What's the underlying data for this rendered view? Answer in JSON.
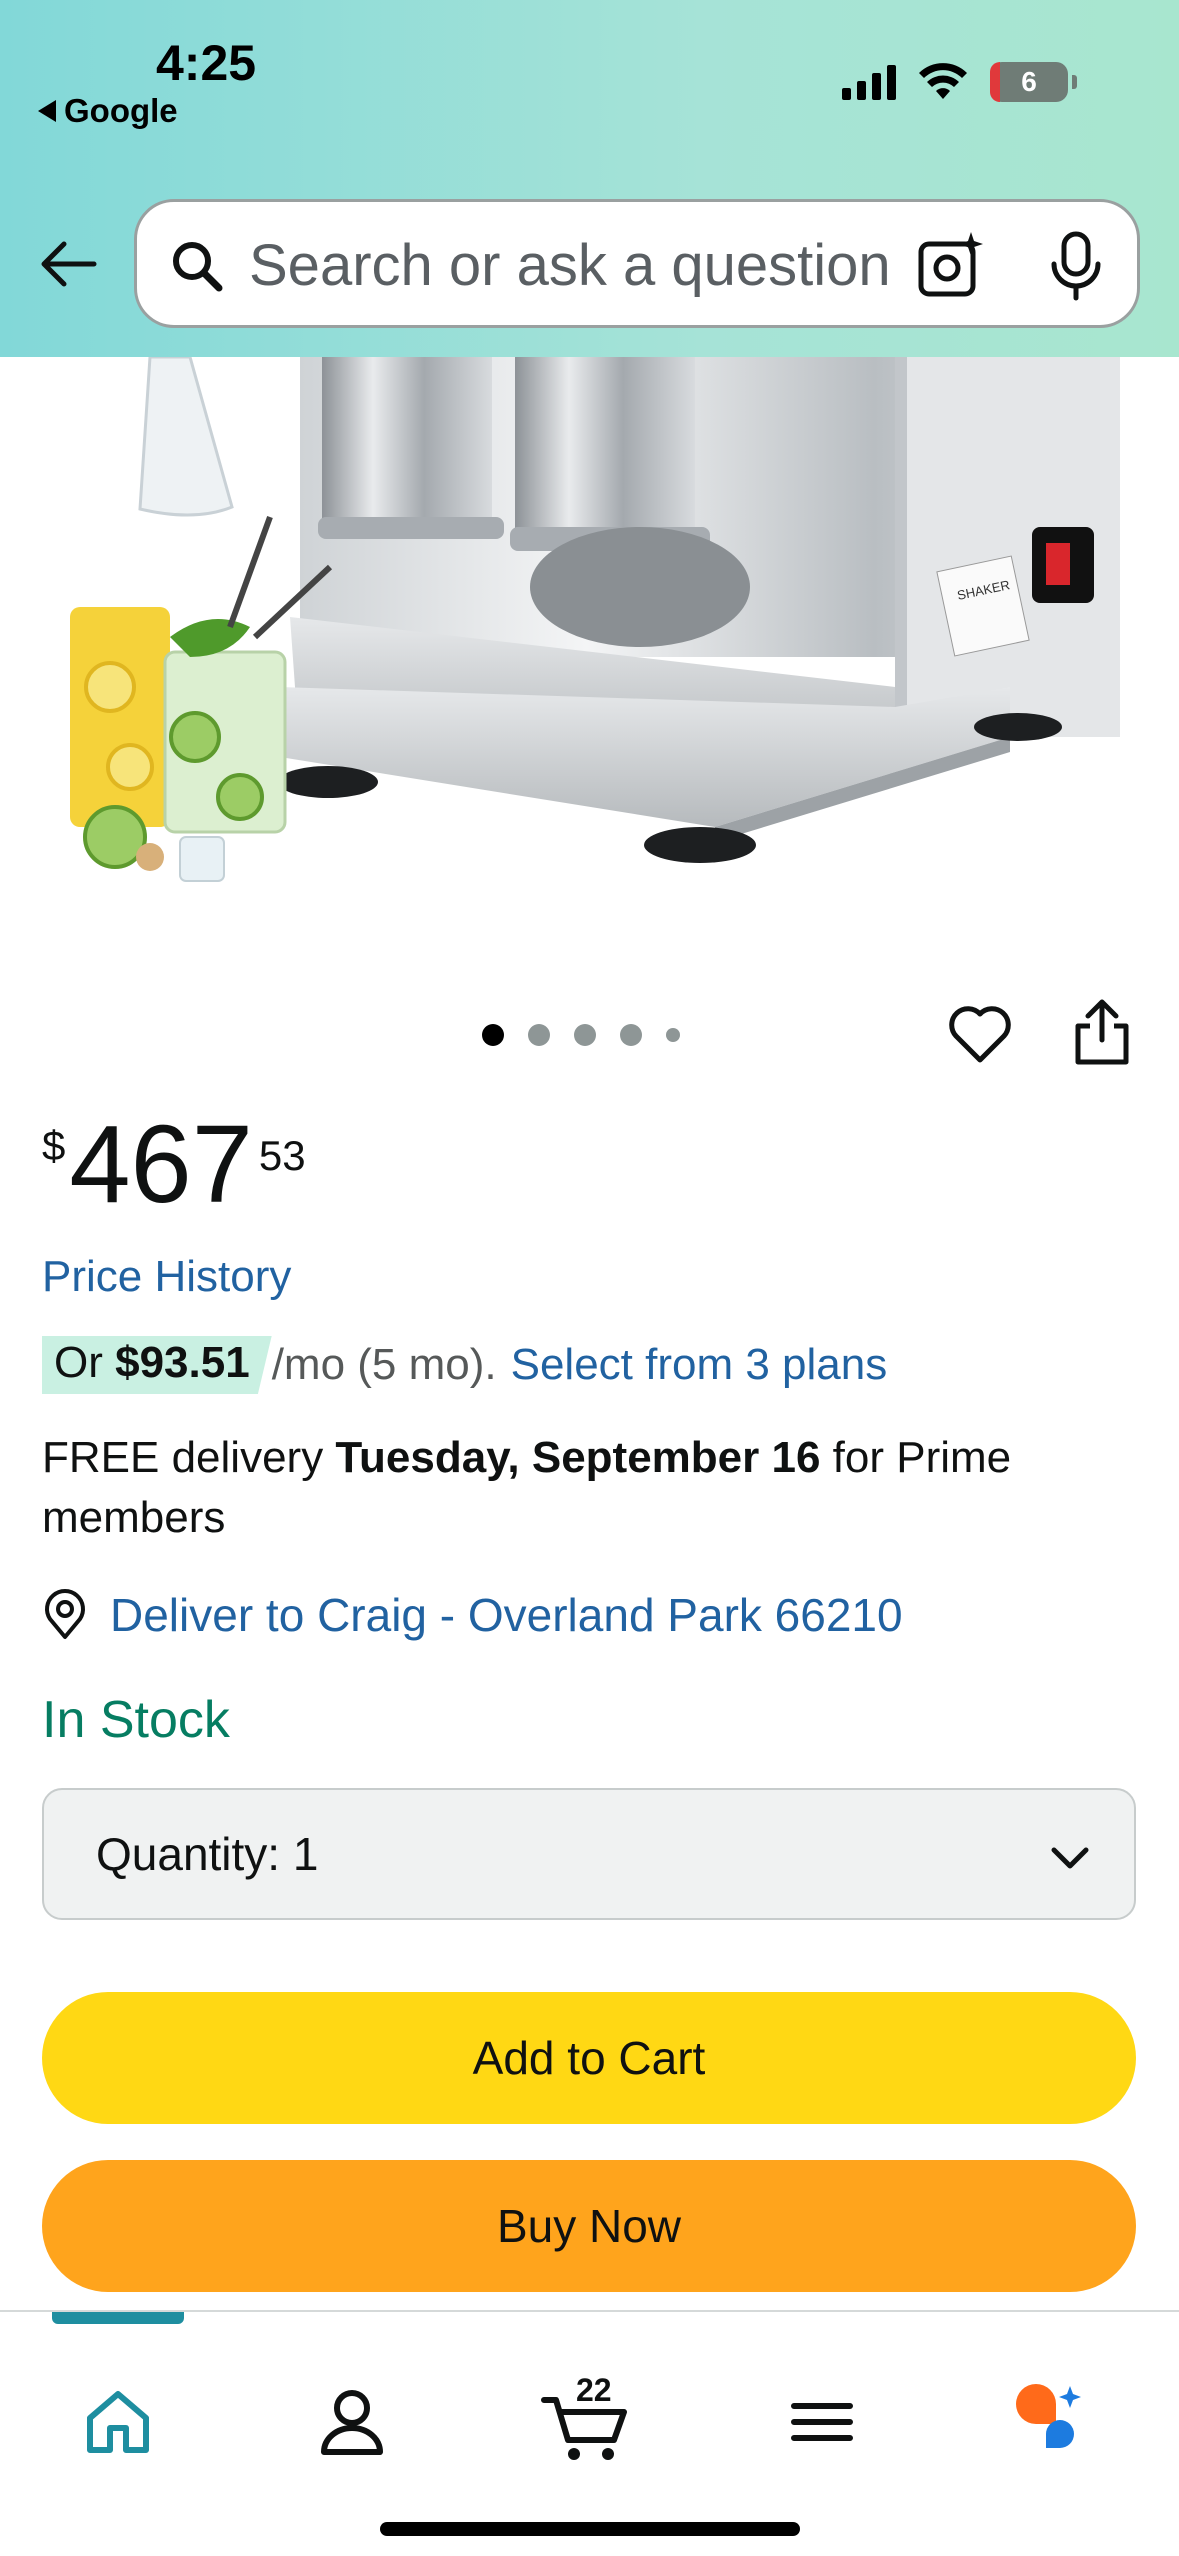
{
  "status_bar": {
    "time": "4:25",
    "back_app": "Google",
    "battery": "6"
  },
  "search": {
    "placeholder": "Search or ask a question"
  },
  "gallery": {
    "dot_count": 5,
    "active_index": 0,
    "label_text": "SHAKER"
  },
  "price": {
    "symbol": "$",
    "whole": "467",
    "fraction": "53"
  },
  "price_history_link": "Price History",
  "installment": {
    "prefix": "Or ",
    "amount": "$93.51",
    "terms": " /mo (5 mo). ",
    "link": "Select from 3 plans"
  },
  "delivery": {
    "prefix": "FREE delivery ",
    "date": "Tuesday, September 16",
    "suffix": " for Prime members"
  },
  "deliver_to": "Deliver to Craig - Overland Park 66210",
  "stock_status": "In Stock",
  "quantity": {
    "label": "Quantity:",
    "value": "1"
  },
  "buttons": {
    "add_to_cart": "Add to Cart",
    "buy_now": "Buy Now"
  },
  "bottom_nav": {
    "cart_count": "22",
    "icons": [
      "home-icon",
      "account-icon",
      "cart-icon",
      "menu-icon",
      "rufus-icon"
    ]
  },
  "colors": {
    "link": "#2162a1",
    "in_stock": "#067d62",
    "add_to_cart": "#ffd814",
    "buy_now": "#ffa41c",
    "nav_active": "#1e8ea0"
  }
}
